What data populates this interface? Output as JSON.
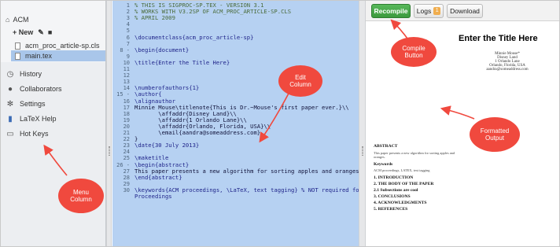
{
  "sidebar": {
    "project_name": "ACM",
    "new_label": "+ New",
    "files": [
      "acm_proc_article-sp.cls",
      "main.tex"
    ],
    "nav": [
      {
        "label": "History",
        "icon": "clock-icon"
      },
      {
        "label": "Collaborators",
        "icon": "person-icon"
      },
      {
        "label": "Settings",
        "icon": "gear-icon"
      },
      {
        "label": "LaTeX Help",
        "icon": "book-icon"
      },
      {
        "label": "Hot Keys",
        "icon": "keyboard-icon"
      }
    ]
  },
  "editor": {
    "lines": [
      {
        "n": "1",
        "text": "% THIS IS SIGPROC-SP.TEX - VERSION 3.1",
        "style": "comment"
      },
      {
        "n": "2",
        "text": "% WORKS WITH V3.2SP OF ACM_PROC_ARTICLE-SP.CLS",
        "style": "comment"
      },
      {
        "n": "3",
        "text": "% APRIL 2009",
        "style": "comment"
      },
      {
        "n": "4",
        "text": "",
        "style": ""
      },
      {
        "n": "5",
        "text": "",
        "style": ""
      },
      {
        "n": "6",
        "text": "\\documentclass{acm_proc_article-sp}",
        "style": "kw"
      },
      {
        "n": "7",
        "text": "",
        "style": ""
      },
      {
        "n": "8 -",
        "text": "\\begin{document}",
        "style": "kw"
      },
      {
        "n": "9",
        "text": "",
        "style": ""
      },
      {
        "n": "10",
        "text": "\\title{Enter the Title Here}",
        "style": "kw"
      },
      {
        "n": "11",
        "text": "",
        "style": ""
      },
      {
        "n": "12",
        "text": "",
        "style": ""
      },
      {
        "n": "13",
        "text": "",
        "style": ""
      },
      {
        "n": "14",
        "text": "\\numberofauthors{1}",
        "style": "kw"
      },
      {
        "n": "15 -",
        "text": "\\author{",
        "style": "kw"
      },
      {
        "n": "16",
        "text": "\\alignauthor",
        "style": "kw"
      },
      {
        "n": "17",
        "text": "Minnie Mouse\\titlenote{This is Dr.~Mouse's first paper ever.}\\\\",
        "style": ""
      },
      {
        "n": "18",
        "text": "       \\affaddr{Disney Land}\\\\",
        "style": ""
      },
      {
        "n": "19",
        "text": "       \\affaddr{1 Orlando Lane}\\\\",
        "style": ""
      },
      {
        "n": "20",
        "text": "       \\affaddr{Orlando, Florida, USA}\\\\",
        "style": ""
      },
      {
        "n": "21",
        "text": "       \\email{aandra@someaddress.com}",
        "style": ""
      },
      {
        "n": "22",
        "text": "}",
        "style": ""
      },
      {
        "n": "23",
        "text": "\\date{30 July 2013}",
        "style": "kw"
      },
      {
        "n": "24",
        "text": "",
        "style": ""
      },
      {
        "n": "25",
        "text": "\\maketitle",
        "style": "kw"
      },
      {
        "n": "26 -",
        "text": "\\begin{abstract}",
        "style": "kw"
      },
      {
        "n": "27",
        "text": "This paper presents a new algorithm for sorting apples and oranges.",
        "style": ""
      },
      {
        "n": "28",
        "text": "\\end{abstract}",
        "style": "kw"
      },
      {
        "n": "29",
        "text": "",
        "style": ""
      },
      {
        "n": "30",
        "text": "\\keywords{ACM proceedings, \\LaTeX, text tagging} % NOT required for",
        "style": "kw"
      },
      {
        "n": "",
        "text": "Proceedings",
        "style": "kw"
      }
    ]
  },
  "toolbar": {
    "recompile_label": "Recompile",
    "logs_label": "Logs",
    "logs_count": "1",
    "download_label": "Download"
  },
  "preview": {
    "title": "Enter the Title Here",
    "author_lines": [
      "Minnie Mouse*",
      "Disney Land",
      "1 Orlando Lane",
      "Orlando, Florida, USA",
      "aandra@someaddress.com"
    ],
    "abstract_heading": "ABSTRACT",
    "abstract_text": "This paper presents a new algorithm for sorting apples and",
    "abstract_text2": "oranges.",
    "keywords_heading": "Keywords",
    "keywords_text": "ACM proceedings, LATEX, text tagging",
    "sections": [
      "1.   INTRODUCTION",
      "2.   THE BODY OF THE PAPER",
      "2.1   Subsections are cool",
      "3.   CONCLUSIONS",
      "4.   ACKNOWLEDGMENTS",
      "5.   REFERENCES"
    ]
  },
  "annotations": {
    "menu": "Menu Column",
    "edit": "Edit Column",
    "compile": "Compile Button",
    "output": "Formatted Output",
    "color": "#f0493e"
  }
}
